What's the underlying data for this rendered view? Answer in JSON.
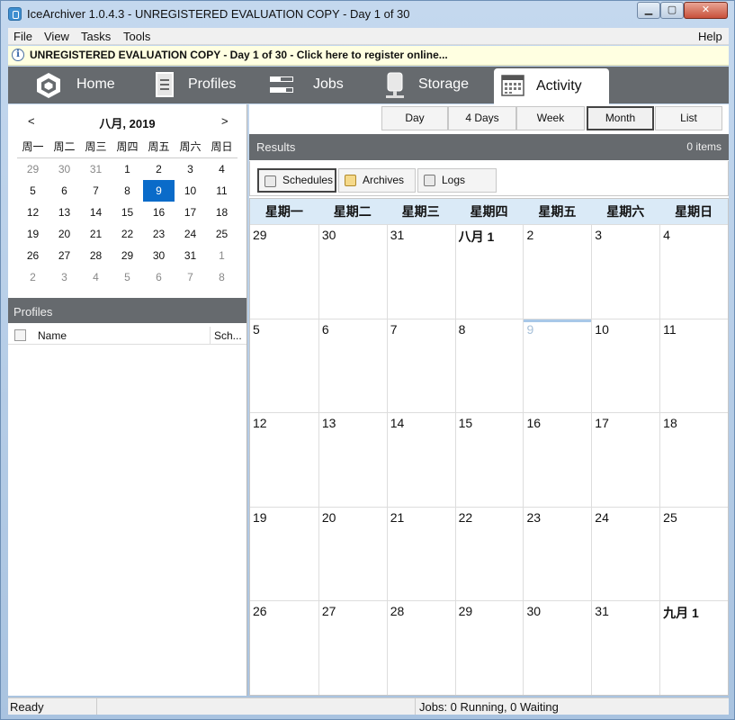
{
  "window": {
    "title": "IceArchiver 1.0.4.3 - UNREGISTERED EVALUATION COPY - Day 1 of 30",
    "minimize": "▁",
    "maximize": "▢",
    "close": "✕"
  },
  "menu": {
    "left": [
      "File",
      "View",
      "Tasks",
      "Tools"
    ],
    "help": "Help"
  },
  "banner": {
    "icon": "i",
    "text": "UNREGISTERED EVALUATION COPY - Day 1 of 30 - Click here to register online..."
  },
  "nav": {
    "tabs": [
      {
        "label": "Home",
        "icon": "hexagon-icon"
      },
      {
        "label": "Profiles",
        "icon": "document-icon"
      },
      {
        "label": "Jobs",
        "icon": "jobs-icon"
      },
      {
        "label": "Storage",
        "icon": "storage-icon"
      },
      {
        "label": "Activity",
        "icon": "calendar-icon",
        "active": true
      }
    ]
  },
  "mini_calendar": {
    "prev": "<",
    "next": ">",
    "month_label": "八月, 2019",
    "weekdays": [
      "周一",
      "周二",
      "周三",
      "周四",
      "周五",
      "周六",
      "周日"
    ],
    "weeks": [
      [
        "29",
        "30",
        "31",
        "1",
        "2",
        "3",
        "4"
      ],
      [
        "5",
        "6",
        "7",
        "8",
        "9",
        "10",
        "11"
      ],
      [
        "12",
        "13",
        "14",
        "15",
        "16",
        "17",
        "18"
      ],
      [
        "19",
        "20",
        "21",
        "22",
        "23",
        "24",
        "25"
      ],
      [
        "26",
        "27",
        "28",
        "29",
        "30",
        "31",
        "1"
      ],
      [
        "2",
        "3",
        "4",
        "5",
        "6",
        "7",
        "8"
      ]
    ],
    "selected": "9"
  },
  "profiles": {
    "title": "Profiles",
    "columns": {
      "name": "Name",
      "schedule": "Sch..."
    }
  },
  "views": {
    "buttons": [
      "Day",
      "4 Days",
      "Week",
      "Month",
      "List"
    ],
    "active": "Month"
  },
  "results": {
    "title": "Results",
    "count": "0 items"
  },
  "subtabs": {
    "items": [
      {
        "label": "Schedules",
        "active": true
      },
      {
        "label": "Archives"
      },
      {
        "label": "Logs"
      }
    ]
  },
  "month_view": {
    "weekdays": [
      "星期一",
      "星期二",
      "星期三",
      "星期四",
      "星期五",
      "星期六",
      "星期日"
    ],
    "weeks": [
      [
        "29",
        "30",
        "31",
        "八月 1",
        "2",
        "3",
        "4"
      ],
      [
        "5",
        "6",
        "7",
        "8",
        "9",
        "10",
        "11"
      ],
      [
        "12",
        "13",
        "14",
        "15",
        "16",
        "17",
        "18"
      ],
      [
        "19",
        "20",
        "21",
        "22",
        "23",
        "24",
        "25"
      ],
      [
        "26",
        "27",
        "28",
        "29",
        "30",
        "31",
        "九月 1"
      ]
    ],
    "today": "9"
  },
  "status": {
    "ready": "Ready",
    "jobs": "Jobs: 0 Running, 0 Waiting"
  }
}
